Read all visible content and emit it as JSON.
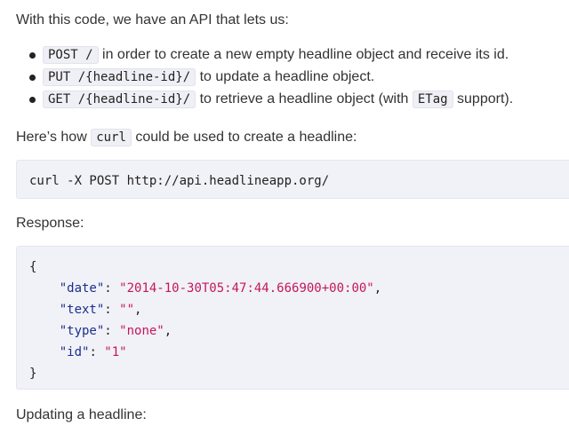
{
  "intro": "With this code, we have an API that lets us:",
  "bullets": [
    {
      "code": "POST /",
      "text": "in order to create a new empty headline object and receive its id."
    },
    {
      "code": "PUT /{headline-id}/",
      "text": "to update a headline object."
    },
    {
      "code": "GET /{headline-id}/",
      "text_before": "to retrieve a headline object (with",
      "code2": "ETag",
      "text_after": "support)."
    }
  ],
  "curl_sentence": {
    "before": "Here’s how",
    "code": "curl",
    "after": "could be used to create a headline:"
  },
  "curl_command": "curl -X POST http://api.headlineapp.org/",
  "response_label": "Response:",
  "response_json": {
    "open": "{",
    "entries": [
      {
        "key": "\"date\"",
        "value": "\"2014-10-30T05:47:44.666900+00:00\"",
        "comma": ","
      },
      {
        "key": "\"text\"",
        "value": "\"\"",
        "comma": ","
      },
      {
        "key": "\"type\"",
        "value": "\"none\"",
        "comma": ","
      },
      {
        "key": "\"id\"",
        "value": "\"1\"",
        "comma": ""
      }
    ],
    "close": "}"
  },
  "updating_label": "Updating a headline:"
}
